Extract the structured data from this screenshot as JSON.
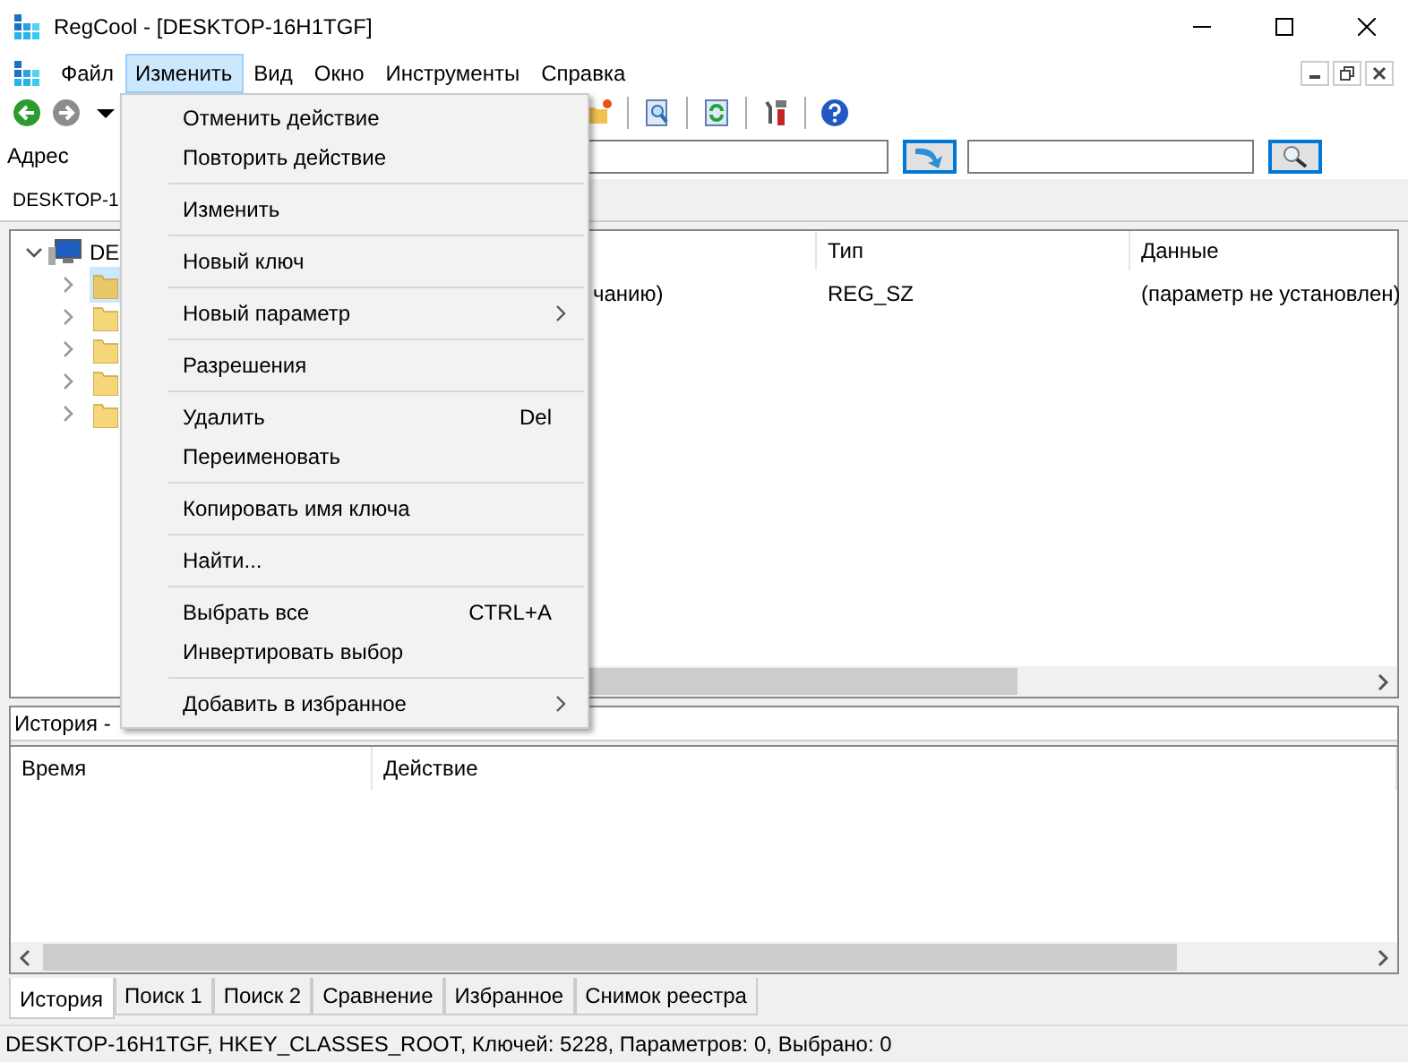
{
  "window": {
    "title": "RegCool - [DESKTOP-16H1TGF]"
  },
  "menu_bar": [
    {
      "label": "Файл",
      "selected": false
    },
    {
      "label": "Изменить",
      "selected": true
    },
    {
      "label": "Вид",
      "selected": false
    },
    {
      "label": "Окно",
      "selected": false
    },
    {
      "label": "Инструменты",
      "selected": false
    },
    {
      "label": "Справка",
      "selected": false
    }
  ],
  "address_bar": {
    "label": "Адрес"
  },
  "document_tabs": [
    {
      "label": "DESKTOP-1",
      "selected": true
    }
  ],
  "tree": {
    "label": "DE",
    "expanded": true,
    "children": [
      {
        "selected": true
      },
      {
        "selected": false
      },
      {
        "selected": false
      },
      {
        "selected": false
      },
      {
        "selected": false
      }
    ]
  },
  "values_table": {
    "columns": [
      "Тип",
      "Данные"
    ],
    "rows": [
      {
        "column_1": "чанию)",
        "type": "REG_SZ",
        "data": "(параметр не установлен)"
      }
    ]
  },
  "edit_menu": [
    {
      "kind": "item",
      "label": "Отменить действие"
    },
    {
      "kind": "item",
      "label": "Повторить действие"
    },
    {
      "kind": "separator"
    },
    {
      "kind": "item",
      "label": "Изменить"
    },
    {
      "kind": "separator"
    },
    {
      "kind": "item",
      "label": "Новый ключ"
    },
    {
      "kind": "separator"
    },
    {
      "kind": "item",
      "label": "Новый параметр",
      "submenu": true
    },
    {
      "kind": "separator"
    },
    {
      "kind": "item",
      "label": "Разрешения"
    },
    {
      "kind": "separator"
    },
    {
      "kind": "item",
      "label": "Удалить",
      "shortcut": "Del"
    },
    {
      "kind": "item",
      "label": "Переименовать"
    },
    {
      "kind": "separator"
    },
    {
      "kind": "item",
      "label": "Копировать имя ключа"
    },
    {
      "kind": "separator"
    },
    {
      "kind": "item",
      "label": "Найти..."
    },
    {
      "kind": "separator"
    },
    {
      "kind": "item",
      "label": "Выбрать все",
      "shortcut": "CTRL+A"
    },
    {
      "kind": "item",
      "label": "Инвертировать выбор"
    },
    {
      "kind": "separator"
    },
    {
      "kind": "item",
      "label": "Добавить в избранное",
      "submenu": true
    }
  ],
  "history": {
    "title": "История -",
    "columns": [
      "Время",
      "Действие"
    ]
  },
  "bottom_tabs": [
    {
      "label": "История",
      "selected": true
    },
    {
      "label": "Поиск 1",
      "selected": false
    },
    {
      "label": "Поиск 2",
      "selected": false
    },
    {
      "label": "Сравнение",
      "selected": false
    },
    {
      "label": "Избранное",
      "selected": false
    },
    {
      "label": "Снимок реестра",
      "selected": false
    }
  ],
  "status_bar": "DESKTOP-16H1TGF, HKEY_CLASSES_ROOT, Ключей: 5228, Параметров: 0, Выбрано: 0"
}
